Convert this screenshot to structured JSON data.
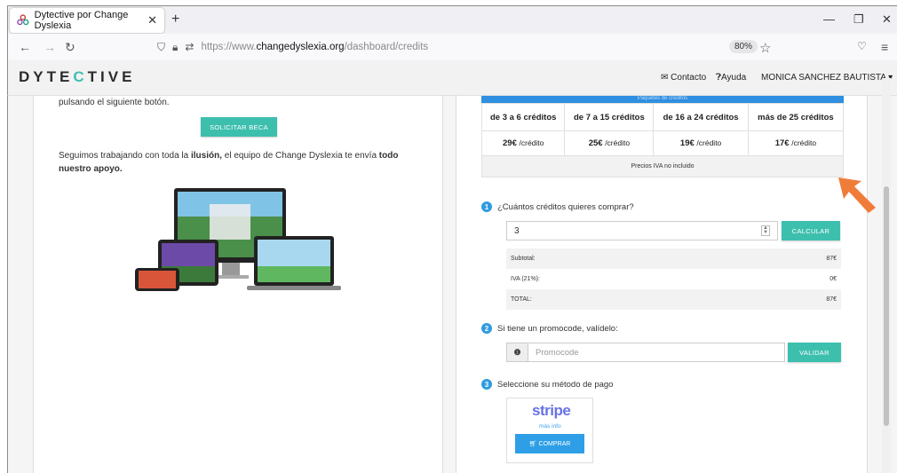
{
  "browser": {
    "tab_title": "Dytective por Change Dyslexia",
    "url_prefix": "https://www.",
    "url_domain": "changedyslexia.org",
    "url_path": "/dashboard/credits",
    "zoom": "80%"
  },
  "header": {
    "logo": {
      "pre": "DYTE",
      "c": "C",
      "post": "TIVE"
    },
    "contact": "Contacto",
    "help": "Ayuda",
    "user": "MONICA SANCHEZ BAUTISTA"
  },
  "left": {
    "intro": "pulsando el siguiente botón.",
    "beca_button": "SOLICITAR BECA",
    "msg_a": "Seguimos trabajando con toda la ",
    "msg_b": "ilusión,",
    "msg_c": " el equipo de Change Dyslexia te envía ",
    "msg_d": "todo nuestro apoyo."
  },
  "pricing": {
    "bar_text": "Paquetes de créditos",
    "tiers": [
      {
        "range": "de 3 a 6 créditos",
        "price": "29€",
        "unit": "/crédito"
      },
      {
        "range": "de 7 a 15 créditos",
        "price": "25€",
        "unit": "/crédito"
      },
      {
        "range": "de 16 a 24 créditos",
        "price": "19€",
        "unit": "/crédito"
      },
      {
        "range": "más de 25 créditos",
        "price": "17€",
        "unit": "/crédito"
      }
    ],
    "note": "Precios IVA no incluido"
  },
  "purchase": {
    "step1": {
      "num": "1",
      "label": "¿Cuántos créditos quieres comprar?"
    },
    "qty_value": "3",
    "calc_button": "CALCULAR",
    "totals": [
      {
        "label": "Subtotal:",
        "value": "87€"
      },
      {
        "label": "IVA (21%):",
        "value": "0€"
      },
      {
        "label": "TOTAL:",
        "value": "87€"
      }
    ],
    "step2": {
      "num": "2",
      "label": "Si tiene un promocode, valídelo:"
    },
    "promo_placeholder": "Promocode",
    "validar_button": "VALIDAR",
    "step3": {
      "num": "3",
      "label": "Seleccione su método de pago"
    },
    "stripe": "stripe",
    "mas_info": "más info",
    "comprar_button": "COMPRAR"
  },
  "colors": {
    "teal": "#3dbfae",
    "blue": "#2f9be0",
    "stripe": "#6772e5",
    "arrow": "#f07c3a"
  }
}
